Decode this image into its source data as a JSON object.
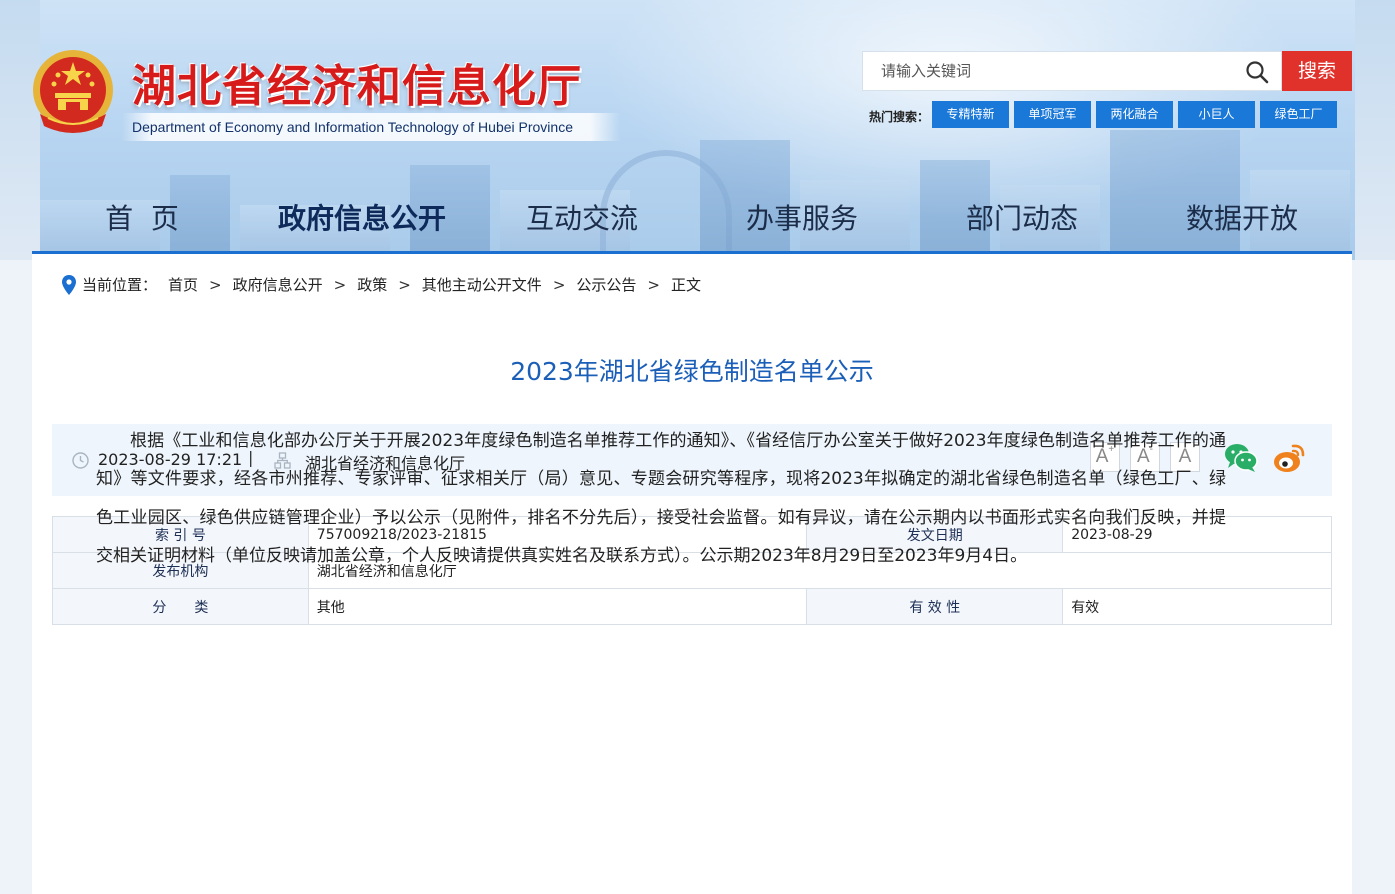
{
  "header": {
    "title_cn": "湖北省经济和信息化厅",
    "title_en": "Department of Economy and Information Technology of Hubei Province",
    "search": {
      "placeholder": "请输入关键词",
      "button": "搜索"
    },
    "hot_label": "热门搜索：",
    "hot_tags": [
      "专精特新",
      "单项冠军",
      "两化融合",
      "小巨人",
      "绿色工厂"
    ]
  },
  "nav": [
    "首  页",
    "政府信息公开",
    "互动交流",
    "办事服务",
    "部门动态",
    "数据开放"
  ],
  "nav_active": 1,
  "breadcrumb": {
    "label": "当前位置：",
    "items": [
      "首页",
      "政府信息公开",
      "政策",
      "其他主动公开文件",
      "公示公告",
      "正文"
    ],
    "separator": ">"
  },
  "article": {
    "title": "2023年湖北省绿色制造名单公示",
    "datetime": "2023-08-29 17:21",
    "divider": "|",
    "publisher": "湖北省经济和信息化厅",
    "font_buttons": [
      "A",
      "A",
      "A"
    ],
    "font_button_marks": [
      "+",
      "-",
      ""
    ],
    "share": [
      "wechat-icon",
      "weibo-icon"
    ],
    "body": "根据《工业和信息化部办公厅关于开展2023年度绿色制造名单推荐工作的通知》、《省经信厅办公室关于做好2023年度绿色制造名单推荐工作的通知》等文件要求，经各市州推荐、专家评审、征求相关厅（局）意见、专题会研究等程序，现将2023年拟确定的湖北省绿色制造名单（绿色工厂、绿色工业园区、绿色供应链管理企业）予以公示（见附件，排名不分先后），接受社会监督。如有异议，请在公示期内以书面形式实名向我们反映，并提交相关证明材料（单位反映请加盖公章，个人反映请提供真实姓名及联系方式）。公示期2023年8月29日至2023年9月4日。"
  },
  "info": {
    "index_label": "索 引 号",
    "index_value": "757009218/2023-21815",
    "date_label": "发文日期",
    "date_value": "2023-08-29",
    "org_label": "发布机构",
    "org_value": "湖北省经济和信息化厅",
    "category_label": "分　　类",
    "category_value": "其他",
    "validity_label": "有 效 性",
    "validity_value": "有效"
  },
  "colors": {
    "accent": "#1a78d8",
    "title_red": "#d71a1a",
    "search_red": "#e0322b",
    "article_title": "#1b5fb8"
  }
}
